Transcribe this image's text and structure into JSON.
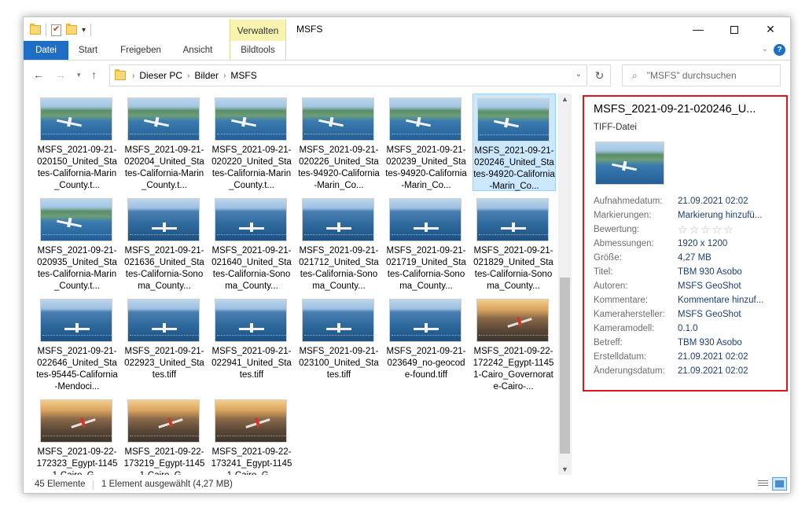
{
  "window": {
    "title": "MSFS",
    "manage_tab": "Verwalten",
    "controls": {
      "minimize": "—",
      "close": "✕"
    }
  },
  "ribbon": {
    "tabs": [
      "Datei",
      "Start",
      "Freigeben",
      "Ansicht",
      "Bildtools"
    ]
  },
  "address": {
    "path": [
      "Dieser PC",
      "Bilder",
      "MSFS"
    ],
    "search_placeholder": "\"MSFS\" durchsuchen"
  },
  "files": [
    {
      "name": "MSFS_2021-09-21-020150_United_States-California-Marin_County.t...",
      "thumb": "coast"
    },
    {
      "name": "MSFS_2021-09-21-020204_United_States-California-Marin_County.t...",
      "thumb": "coast"
    },
    {
      "name": "MSFS_2021-09-21-020220_United_States-California-Marin_County.t...",
      "thumb": "coast"
    },
    {
      "name": "MSFS_2021-09-21-020226_United_States-94920-California-Marin_Co...",
      "thumb": "coast"
    },
    {
      "name": "MSFS_2021-09-21-020239_United_States-94920-California-Marin_Co...",
      "thumb": "coast"
    },
    {
      "name": "MSFS_2021-09-21-020246_United_States-94920-California-Marin_Co...",
      "thumb": "coast",
      "selected": true
    },
    {
      "name": "MSFS_2021-09-21-020935_United_States-California-Marin_County.t...",
      "thumb": "coast"
    },
    {
      "name": "MSFS_2021-09-21-021636_United_States-California-Sonoma_County...",
      "thumb": "sea"
    },
    {
      "name": "MSFS_2021-09-21-021640_United_States-California-Sonoma_County...",
      "thumb": "sea"
    },
    {
      "name": "MSFS_2021-09-21-021712_United_States-California-Sonoma_County...",
      "thumb": "sea"
    },
    {
      "name": "MSFS_2021-09-21-021719_United_States-California-Sonoma_County...",
      "thumb": "sea"
    },
    {
      "name": "MSFS_2021-09-21-021829_United_States-California-Sonoma_County...",
      "thumb": "sea"
    },
    {
      "name": "MSFS_2021-09-21-022646_United_States-95445-California-Mendoci...",
      "thumb": "sea"
    },
    {
      "name": "MSFS_2021-09-21-022923_United_States.tiff",
      "thumb": "sea"
    },
    {
      "name": "MSFS_2021-09-21-022941_United_States.tiff",
      "thumb": "sea"
    },
    {
      "name": "MSFS_2021-09-21-023100_United_States.tiff",
      "thumb": "sea"
    },
    {
      "name": "MSFS_2021-09-21-023649_no-geocode-found.tiff",
      "thumb": "sea"
    },
    {
      "name": "MSFS_2021-09-22-172242_Egypt-11451-Cairo_Governorate-Cairo-...",
      "thumb": "desert"
    },
    {
      "name": "MSFS_2021-09-22-172323_Egypt-11451-Cairo_G...",
      "thumb": "desert"
    },
    {
      "name": "MSFS_2021-09-22-173219_Egypt-11451-Cairo_G...",
      "thumb": "desert"
    },
    {
      "name": "MSFS_2021-09-22-173241_Egypt-11451-Cairo_G...",
      "thumb": "desert"
    }
  ],
  "details": {
    "title": "MSFS_2021-09-21-020246_U...",
    "type": "TIFF-Datei",
    "properties": [
      {
        "key": "Aufnahmedatum:",
        "value": "21.09.2021 02:02"
      },
      {
        "key": "Markierungen:",
        "value": "Markierung hinzufü..."
      },
      {
        "key": "Bewertung:",
        "value": "",
        "stars": 0
      },
      {
        "key": "Abmessungen:",
        "value": "1920 x 1200"
      },
      {
        "key": "Größe:",
        "value": "4,27 MB"
      },
      {
        "key": "Titel:",
        "value": "TBM 930 Asobo"
      },
      {
        "key": "Autoren:",
        "value": "MSFS GeoShot"
      },
      {
        "key": "Kommentare:",
        "value": "Kommentare hinzuf..."
      },
      {
        "key": "Kamerahersteller:",
        "value": "MSFS GeoShot"
      },
      {
        "key": "Kameramodell:",
        "value": "0.1.0"
      },
      {
        "key": "Betreff:",
        "value": "TBM 930 Asobo"
      },
      {
        "key": "Erstelldatum:",
        "value": "21.09.2021 02:02"
      },
      {
        "key": "Änderungsdatum:",
        "value": "21.09.2021 02:02"
      }
    ]
  },
  "status": {
    "count": "45 Elemente",
    "selection": "1 Element ausgewählt (4,27 MB)"
  }
}
